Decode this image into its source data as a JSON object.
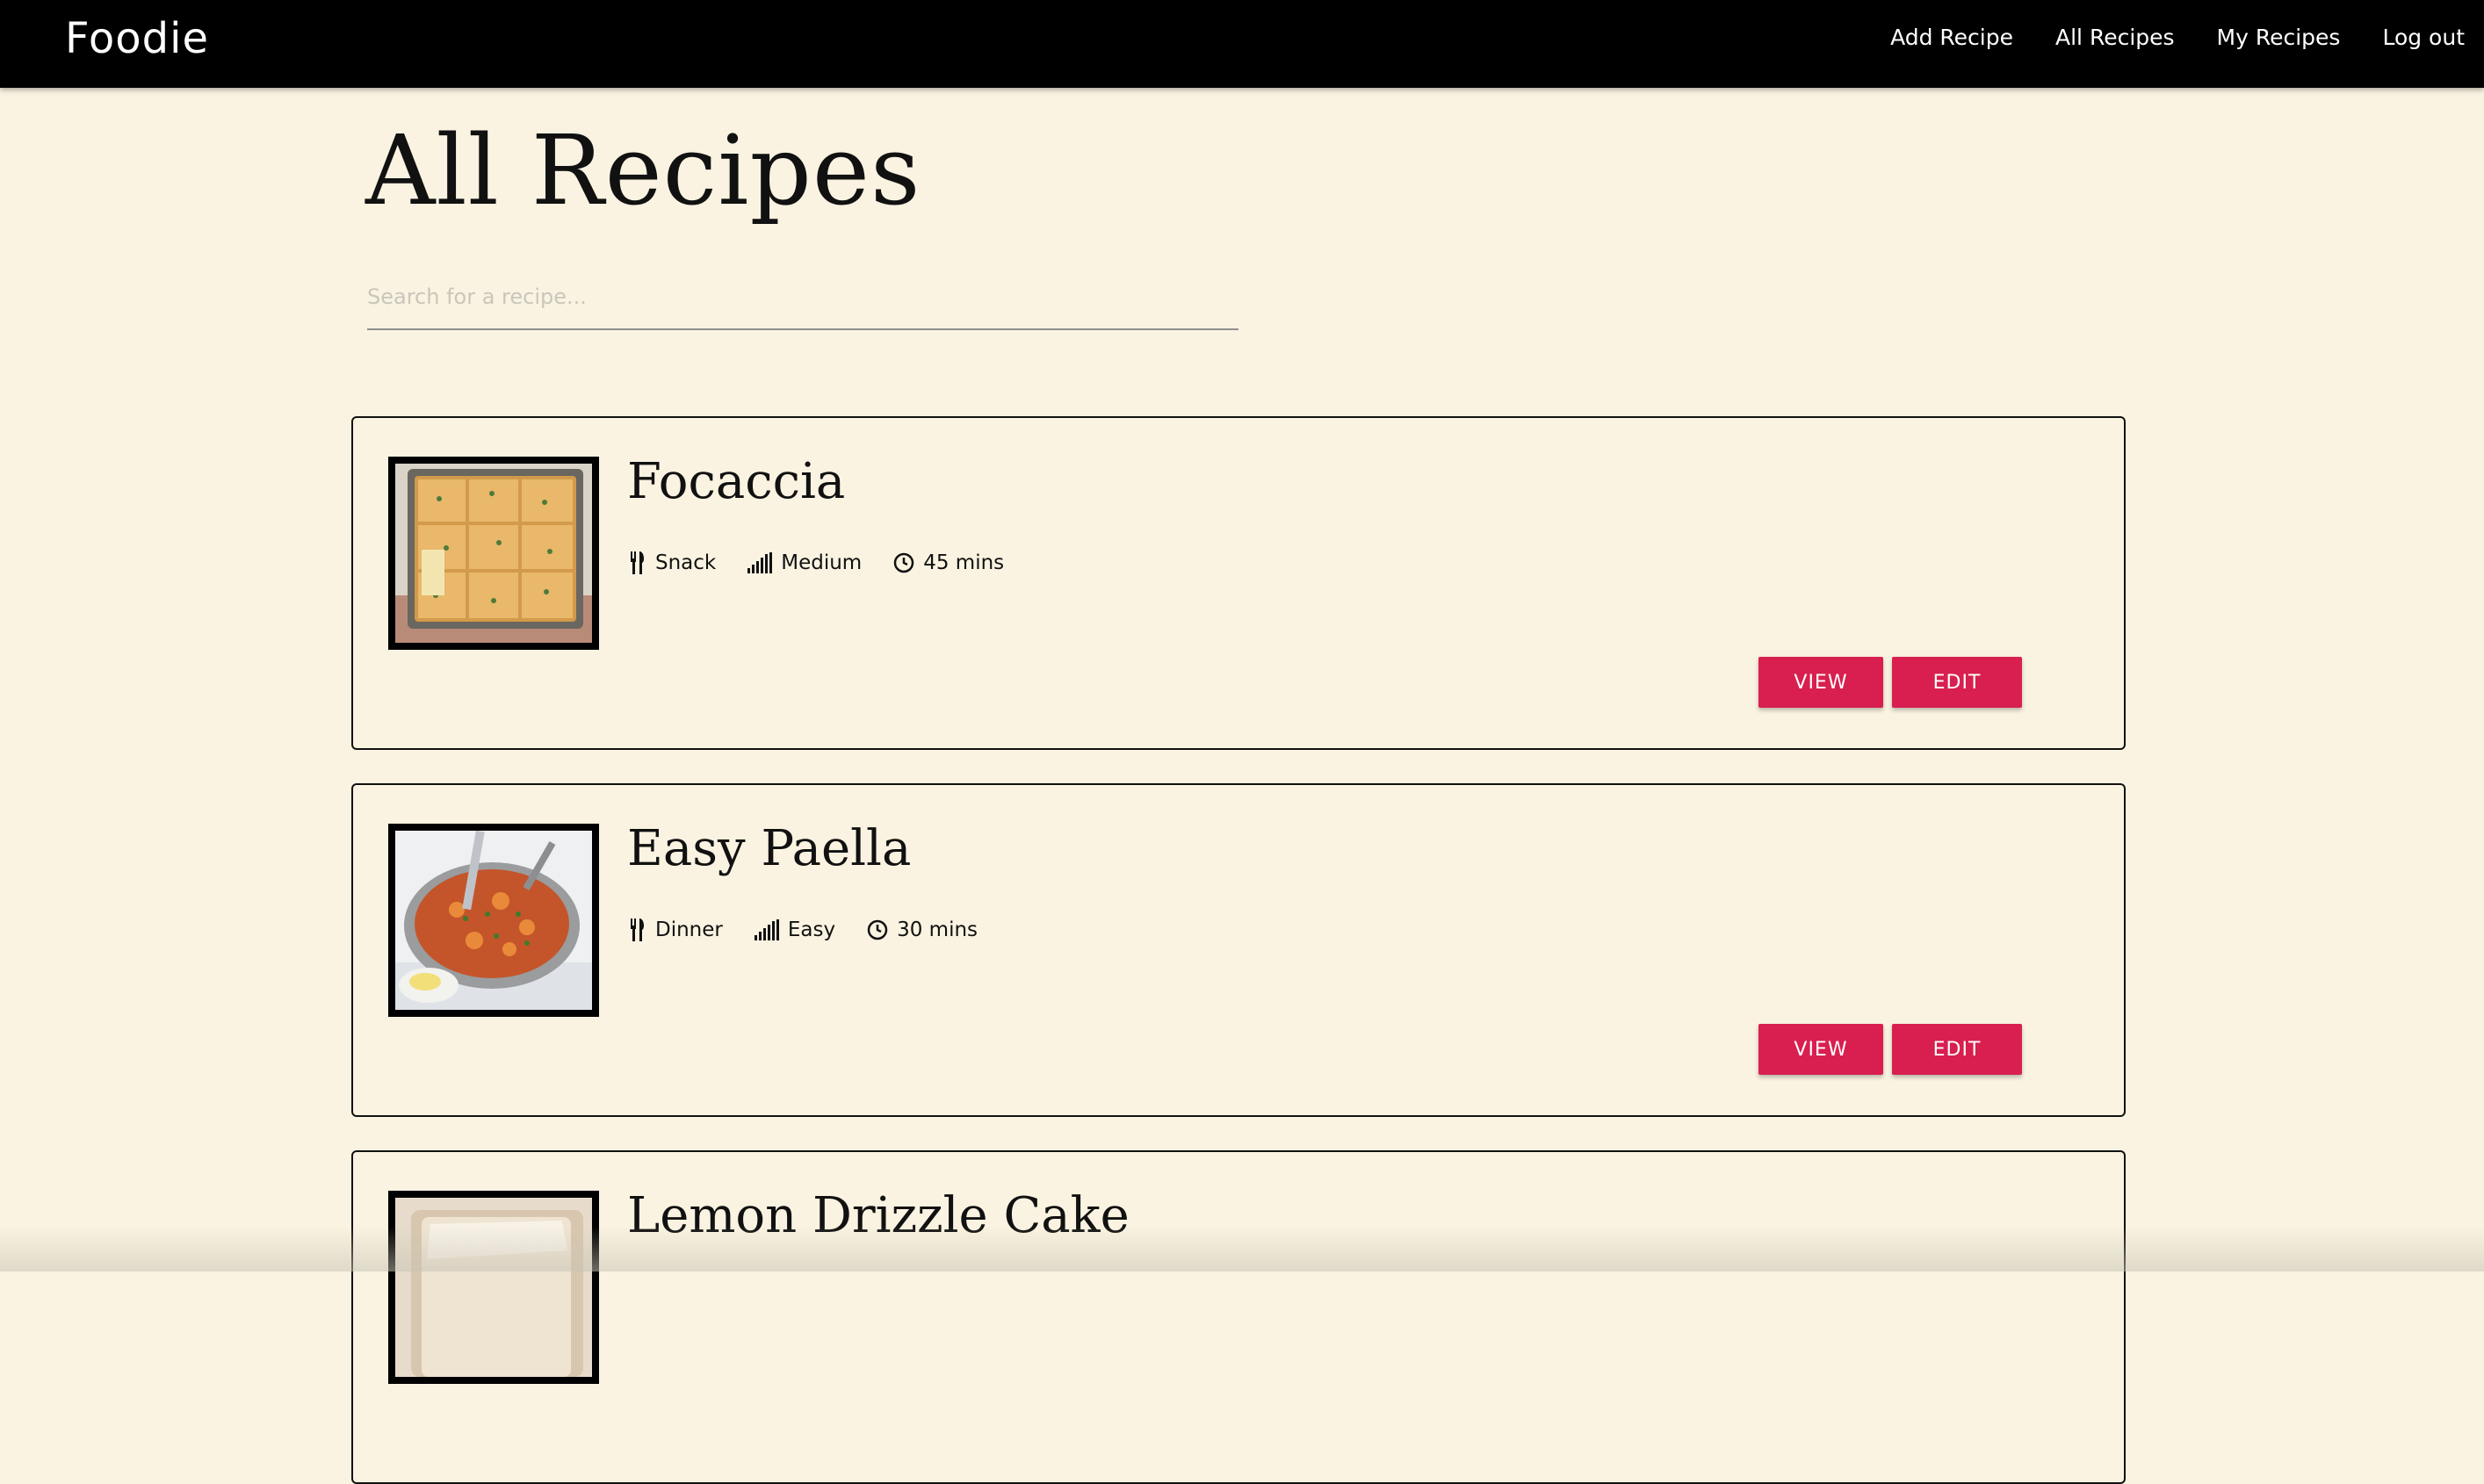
{
  "nav": {
    "brand": "Foodie",
    "links": [
      "Add Recipe",
      "All Recipes",
      "My Recipes",
      "Log out"
    ]
  },
  "page": {
    "title": "All Recipes"
  },
  "search": {
    "placeholder": "Search for a recipe...",
    "value": ""
  },
  "recipes": [
    {
      "title": "Focaccia",
      "category": "Snack",
      "difficulty": "Medium",
      "time": "45 mins",
      "view_label": "VIEW",
      "edit_label": "EDIT"
    },
    {
      "title": "Easy Paella",
      "category": "Dinner",
      "difficulty": "Easy",
      "time": "30 mins",
      "view_label": "VIEW",
      "edit_label": "EDIT"
    },
    {
      "title": "Lemon Drizzle Cake"
    }
  ],
  "colors": {
    "background": "#faf3e1",
    "navbar": "#000000",
    "accent": "#d81f4f"
  },
  "icons": {
    "category": "utensils-icon",
    "difficulty": "signal-bars-icon",
    "time": "clock-icon"
  }
}
